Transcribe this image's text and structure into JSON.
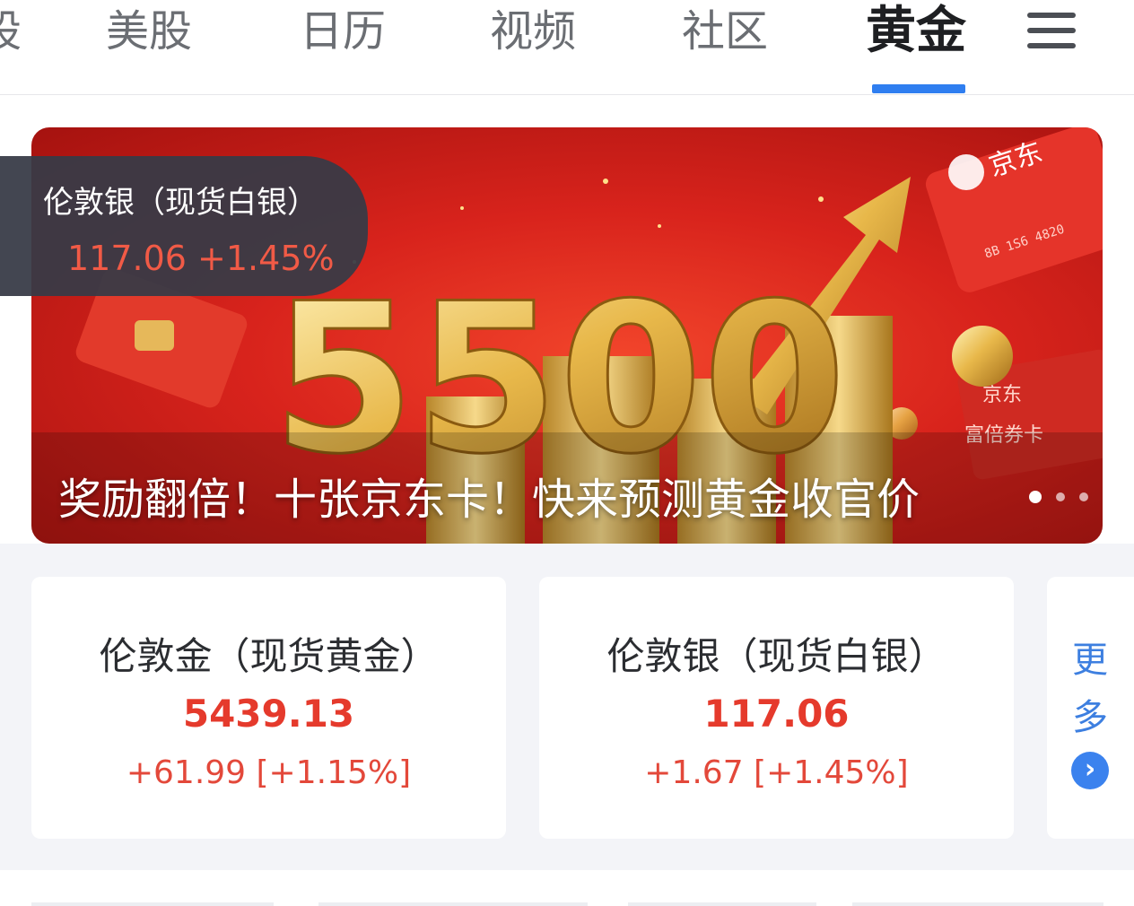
{
  "nav": {
    "partial_tab": "股",
    "tabs": [
      "美股",
      "日历",
      "视频",
      "社区"
    ],
    "active_tab": "黄金",
    "menu_icon": "hamburger-menu-icon",
    "accent_color": "#2f7ef0"
  },
  "banner": {
    "caption": "奖励翻倍！十张京东卡！快来预测黄金收官价",
    "big_number": "5500",
    "card_brand": "京东",
    "card_number": "8B 1S6 4820",
    "card_title": "富倍券卡",
    "slide_count": 3,
    "active_slide": 1
  },
  "popup": {
    "title": "伦敦银（现货白银）",
    "value": "117.06 +1.45%"
  },
  "quotes": [
    {
      "name": "伦敦金（现货黄金）",
      "price": "5439.13",
      "change": "+61.99 [+1.15%]"
    },
    {
      "name": "伦敦银（现货白银）",
      "price": "117.06",
      "change": "+1.67 [+1.45%]"
    }
  ],
  "more": {
    "char1": "更",
    "char2": "多",
    "arrow_icon": "chevron-right-icon"
  },
  "colors": {
    "up": "#e53a2c",
    "link": "#3d7fe0"
  }
}
